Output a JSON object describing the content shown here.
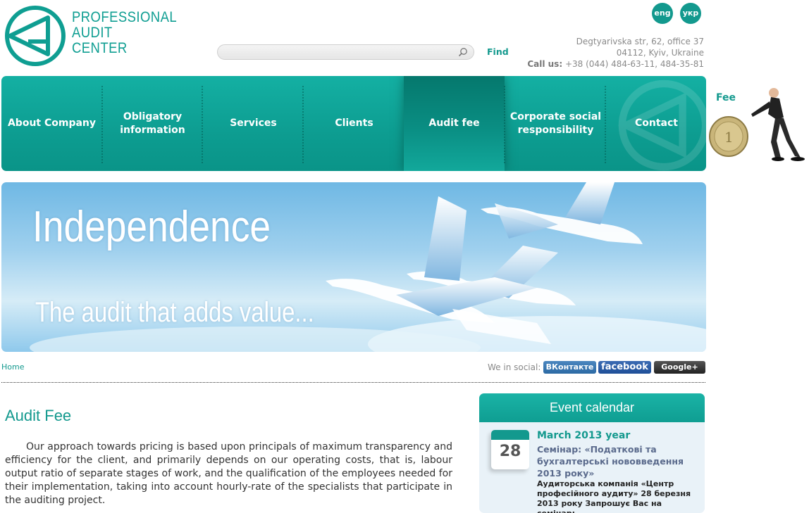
{
  "logo": {
    "line1": "PROFESSIONAL",
    "line2": "AUDIT",
    "line3": "CENTER"
  },
  "languages": [
    "eng",
    "укр"
  ],
  "search": {
    "placeholder": "",
    "find_label": "Find"
  },
  "address": {
    "line1": "Degtyarivska str, 62, office 37",
    "line2": "04112, Kyiv, Ukraine",
    "call_label": "Call us:",
    "phones": " +38 (044) 484-63-11, 484-35-81"
  },
  "nav": {
    "items": [
      {
        "label": "About Company"
      },
      {
        "label": "Obligatory information"
      },
      {
        "label": "Services"
      },
      {
        "label": "Clients"
      },
      {
        "label": "Audit fee",
        "active": true
      },
      {
        "label": "Corporate social responsibility"
      },
      {
        "label": "Contact"
      }
    ]
  },
  "fee_image": {
    "label": "Fee"
  },
  "banner": {
    "title": "Independence",
    "subtitle": "The audit that adds value..."
  },
  "breadcrumb": {
    "home": "Home"
  },
  "social": {
    "label": "We in social:",
    "vk": "ВКонтакте",
    "facebook": "facebook",
    "google": "Google+"
  },
  "main": {
    "title": "Audit Fee",
    "paragraph": "Our approach towards pricing is based upon principals of maximum transparency and efficiency for the client, and primarily depends on our operating costs, that is, labour output ratio of separate stages of work, and the qualification of the employees needed for their implementation, taking into account hourly-rate of the specialists that participate in the auditing project."
  },
  "event_calendar": {
    "title": "Event calendar",
    "day": "28",
    "month": "March 2013 year",
    "event_title": "Семінар: «Податкові та бухгалтерські нововведення 2013 року»",
    "event_desc": "Аудиторська компанія «Центр професійного аудиту» 28 березня 2013 року   Запрошує Вас на семінар:"
  },
  "colors": {
    "brand": "#13998e",
    "nav_active": "#05786d",
    "link": "#5a6a8c"
  }
}
